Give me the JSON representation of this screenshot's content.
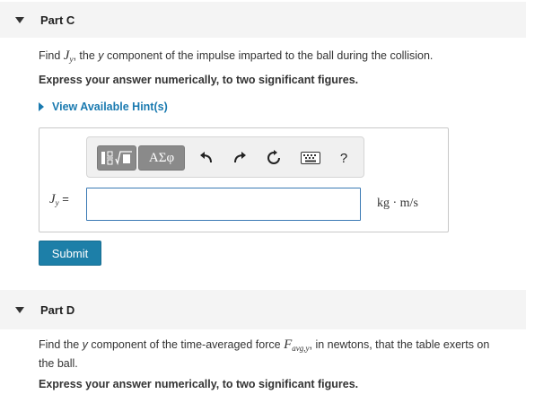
{
  "part_c": {
    "title": "Part C",
    "question": {
      "prefix": "Find ",
      "symbol": "J",
      "symbol_sub": "y",
      "middle": ", the ",
      "y_word": "y",
      "suffix": " component of the impulse imparted to the ball during the collision."
    },
    "instruction": "Express your answer numerically, to two significant figures.",
    "hint_label": "View Available Hint(s)",
    "toolbar": {
      "templates_icon": "fraction-sqrt-icon",
      "symbols_label": "ΑΣφ",
      "undo_icon": "undo-icon",
      "redo_icon": "redo-icon",
      "reset_icon": "reset-icon",
      "keyboard_icon": "keyboard-icon",
      "help_label": "?"
    },
    "answer": {
      "label_symbol": "J",
      "label_sub": "y",
      "label_eq": " =",
      "value": "",
      "units": "kg · m/s"
    },
    "submit_label": "Submit"
  },
  "part_d": {
    "title": "Part D",
    "question": {
      "prefix": "Find the ",
      "y_word": "y",
      "middle": " component of the time-averaged force ",
      "symbol": "F",
      "symbol_sub": "avg,y",
      "suffix": ", in newtons, that the table exerts on",
      "line2": "the ball."
    },
    "instruction": "Express your answer numerically, to two significant figures."
  },
  "colors": {
    "header_bg": "#f4f4f4",
    "link": "#1a7ab0",
    "submit_bg": "#1d7fa8",
    "input_border": "#3b7ab4",
    "toolbar_button": "#8a8a8a"
  }
}
